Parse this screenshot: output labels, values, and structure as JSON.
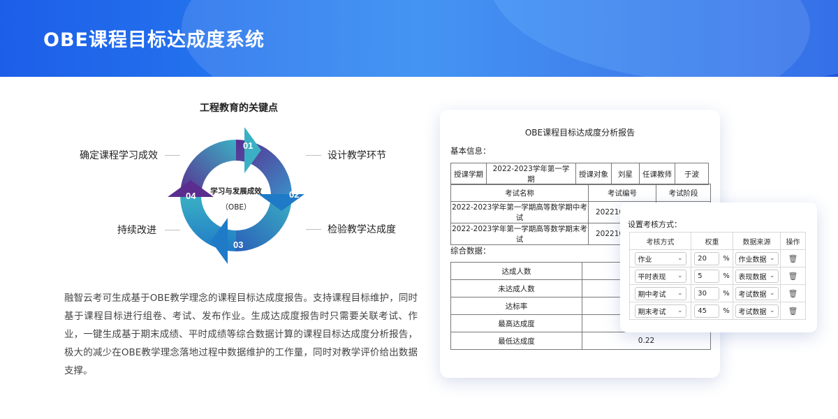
{
  "header": {
    "title": "OBE课程目标达成度系统"
  },
  "cycle": {
    "title": "工程教育的关键点",
    "center_title": "学习与发展成效",
    "center_subtitle": "（OBE）",
    "steps": [
      {
        "num": "01",
        "label": "设计教学环节"
      },
      {
        "num": "02",
        "label": "检验教学达成度"
      },
      {
        "num": "03",
        "label": "持续改进"
      },
      {
        "num": "04",
        "label": "确定课程学习成效"
      }
    ],
    "colors": {
      "teal": "#3bb0c4",
      "purple": "#5a2d8f",
      "blue": "#1f7ac7"
    }
  },
  "description": "融智云考可生成基于OBE教学理念的课程目标达成度报告。支持课程目标维护，同时基于课程目标进行组卷、考试、发布作业。生成达成度报告时只需要关联考试、作业，一键生成基于期末成绩、平时成绩等综合数据计算的课程目标达成度分析报告，极大的减少在OBE教学理念落地过程中数据维护的工作量，同时对教学评价给出数据支撑。",
  "report": {
    "title": "OBE课程目标达成度分析报告",
    "basic_label": "基本信息：",
    "basic": [
      "授课学期",
      "2022-2023学年第一学期",
      "授课对象",
      "刘星",
      "任课教师",
      "于波"
    ],
    "exam_headers": [
      "考试名称",
      "考试编号",
      "考试阶段"
    ],
    "exams": [
      [
        "2022-2023学年第一学期高等数学期中考试",
        "2022103",
        ""
      ],
      [
        "2022-2023学年第一学期高等数学期末考试",
        "2022103",
        ""
      ]
    ],
    "summary_label": "综合数据：",
    "summary": [
      [
        "达成人数",
        ""
      ],
      [
        "未达成人数",
        ""
      ],
      [
        "达标率",
        ""
      ],
      [
        "最高达成度",
        ""
      ],
      [
        "最低达成度",
        "0.22"
      ]
    ]
  },
  "settings": {
    "title": "设置考核方式：",
    "headers": [
      "考核方式",
      "权重",
      "数据来源",
      "操作"
    ],
    "percent_symbol": "%",
    "rows": [
      {
        "method": "作业",
        "weight": "20",
        "source": "作业数据"
      },
      {
        "method": "平时表现",
        "weight": "5",
        "source": "表现数据"
      },
      {
        "method": "期中考试",
        "weight": "30",
        "source": "考试数据"
      },
      {
        "method": "期末考试",
        "weight": "45",
        "source": "考试数据"
      }
    ]
  }
}
